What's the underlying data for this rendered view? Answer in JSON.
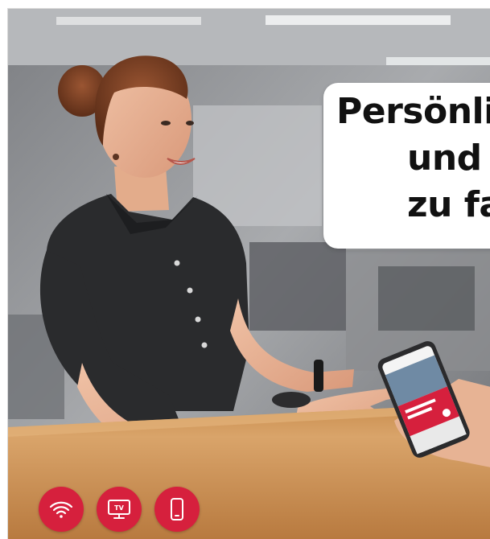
{
  "headline": {
    "line1": "Persönli",
    "line2": "und ",
    "line3": "zu fa"
  },
  "icons": [
    {
      "name": "wifi-icon",
      "color": "#d6203d"
    },
    {
      "name": "tv-icon",
      "color": "#d6203d",
      "label": "TV"
    },
    {
      "name": "smartphone-icon",
      "color": "#d6203d"
    }
  ],
  "brand_color": "#d6203d"
}
